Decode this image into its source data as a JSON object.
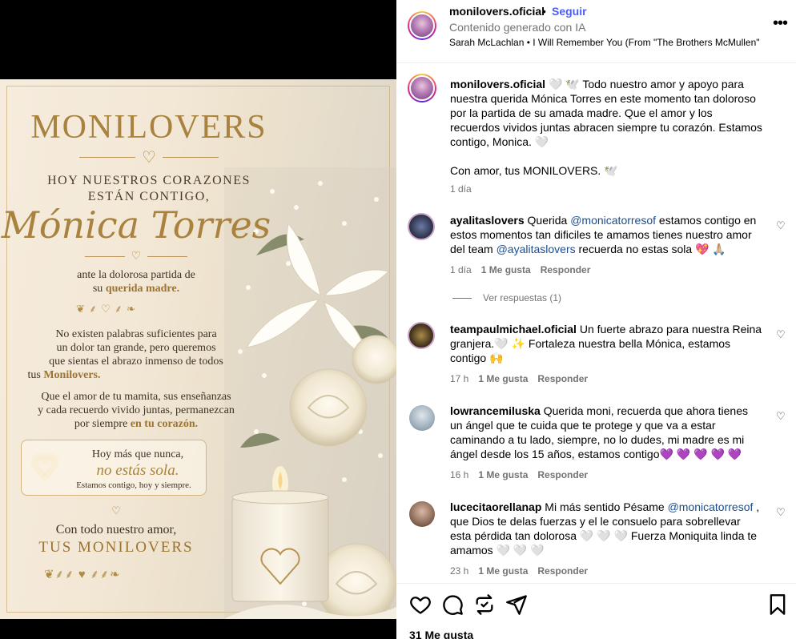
{
  "poster": {
    "brand": "MONILOVERS",
    "line1": "HOY NUESTROS CORAZONES",
    "line2": "ESTÁN CONTIGO,",
    "name": "Mónica Torres",
    "sub1": "ante la dolorosa partida de",
    "sub2_pre": "su ",
    "sub2_gold": "querida madre.",
    "p1_l1": "No existen palabras suficientes para",
    "p1_l2": "un dolor tan grande, pero queremos",
    "p1_l3": "que sientas el abrazo inmenso de todos",
    "p1_l4_pre": "tus ",
    "p1_l4_gold": "Monilovers.",
    "p2_l1": "Que el amor de tu mamita, sus enseñanzas",
    "p2_l2": "y cada recuerdo vivido juntas, permanezcan",
    "p2_l3_pre": "por siempre ",
    "p2_l3_gold": "en tu corazón.",
    "box_l1": "Hoy más que nunca,",
    "box_l2": "no estás sola.",
    "box_l3": "Estamos contigo, hoy y siempre.",
    "closing1": "Con todo nuestro amor,",
    "closing2": "TUS MONILOVERS"
  },
  "header": {
    "username": "monilovers.oficial",
    "dot": "•",
    "follow": "Seguir",
    "ai_label": "Contenido generado con IA",
    "song": "Sarah McLachlan • I Will Remember You (From \"The Brothers McMullen\""
  },
  "caption": {
    "username": "monilovers.oficial",
    "text": "🤍 🕊️ Todo nuestro amor y apoyo para nuestra querida Mónica Torres en este momento tan doloroso por la partida de su amada madre. Que el amor y los recuerdos vividos juntas abracen siempre tu corazón. Estamos contigo, Monica. 🤍",
    "signoff": "Con amor, tus MONILOVERS. 🕊️",
    "time": "1 día"
  },
  "comments": [
    {
      "username": "ayalitaslovers",
      "pre": " Querida ",
      "mention1": "@monicatorresof",
      "mid": " estamos contigo en estos momentos tan dificiles te amamos tienes nuestro amor del team ",
      "mention2": "@ayalitaslovers",
      "post": " recuerda no estas sola 💖 🙏🏼",
      "time": "1 día",
      "likes": "1 Me gusta",
      "reply": "Responder"
    },
    {
      "username": "teampaulmichael.oficial",
      "text": " Un fuerte abrazo para nuestra Reina granjera.🤍 ✨ Fortaleza nuestra bella Mónica, estamos contigo 🙌",
      "time": "17 h",
      "likes": "1 Me gusta",
      "reply": "Responder"
    },
    {
      "username": "lowrancemiluska",
      "text": " Querida moni, recuerda que ahora tienes un ángel que te cuida que te protege y que va a estar caminando a tu lado, siempre, no lo dudes, mi madre es mi ángel desde los 15 años, estamos contigo💜 💜 💜 💜 💜",
      "time": "16 h",
      "likes": "1 Me gusta",
      "reply": "Responder"
    },
    {
      "username": "lucecitaorellanap",
      "pre": " Mi más sentido Pésame ",
      "mention1": "@monicatorresof",
      "post": " , que Dios te delas fuerzas y el le consuelo para sobrellevar esta pérdida tan dolorosa 🤍 🤍 🤍  Fuerza Moniquita linda te amamos 🤍 🤍 🤍",
      "time": "23 h",
      "likes": "1 Me gusta",
      "reply": "Responder"
    }
  ],
  "view_replies": "Ver respuestas (1)",
  "likes_count": "31 Me gusta",
  "colors": {
    "follow": "#4a5df9",
    "mention": "#1a4d8f",
    "gold": "#a8823e"
  }
}
